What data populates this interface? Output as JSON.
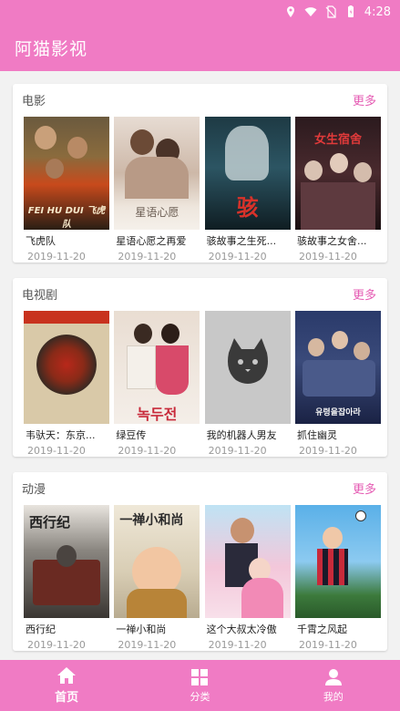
{
  "status": {
    "time": "4:28"
  },
  "app": {
    "title": "阿猫影视"
  },
  "colors": {
    "accent": "#f07bc4",
    "more": "#e55bb3"
  },
  "sections": [
    {
      "title": "电影",
      "more": "更多",
      "items": [
        {
          "title": "飞虎队",
          "date": "2019-11-20",
          "poster_text": "FEI HU DUI 飞虎队"
        },
        {
          "title": "星语心愿之再爱",
          "date": "2019-11-20",
          "poster_text": "星语心愿"
        },
        {
          "title": "骇故事之生死...",
          "date": "2019-11-20",
          "poster_text": "骇"
        },
        {
          "title": "骇故事之女舍...",
          "date": "2019-11-20",
          "poster_text": "女生宿舍"
        }
      ]
    },
    {
      "title": "电视剧",
      "more": "更多",
      "items": [
        {
          "title": "韦驮天：东京...",
          "date": "2019-11-20",
          "poster_text": ""
        },
        {
          "title": "绿豆传",
          "date": "2019-11-20",
          "poster_text": "녹두전"
        },
        {
          "title": "我的机器人男友",
          "date": "2019-11-20",
          "poster_text": ""
        },
        {
          "title": "抓住幽灵",
          "date": "2019-11-20",
          "poster_text": "유령을잡아라"
        }
      ]
    },
    {
      "title": "动漫",
      "more": "更多",
      "items": [
        {
          "title": "西行纪",
          "date": "2019-11-20",
          "poster_text": "西行纪"
        },
        {
          "title": "一禅小和尚",
          "date": "2019-11-20",
          "poster_text": "一禅小和尚"
        },
        {
          "title": "这个大叔太冷傲",
          "date": "2019-11-20",
          "poster_text": ""
        },
        {
          "title": "千霄之风起",
          "date": "2019-11-20",
          "poster_text": ""
        }
      ]
    }
  ],
  "tabs": [
    {
      "label": "首页",
      "icon": "home-icon",
      "active": true
    },
    {
      "label": "分类",
      "icon": "grid-icon",
      "active": false
    },
    {
      "label": "我的",
      "icon": "user-icon",
      "active": false
    }
  ]
}
